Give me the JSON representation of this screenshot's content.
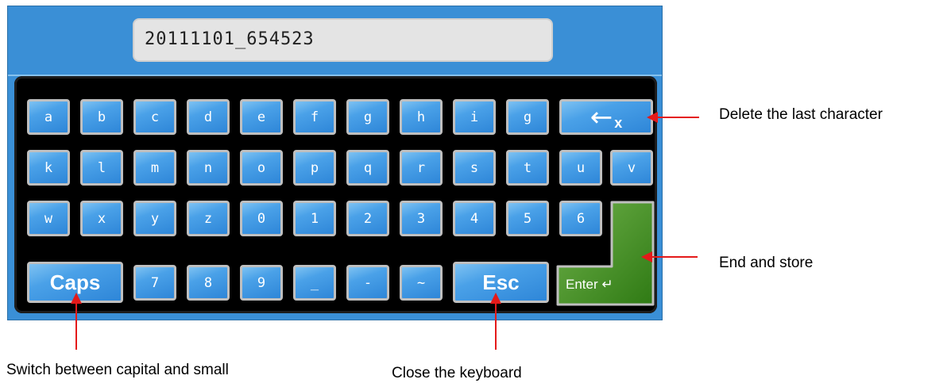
{
  "display": {
    "value": "20111101_654523"
  },
  "keys": {
    "row1": [
      "a",
      "b",
      "c",
      "d",
      "e",
      "f",
      "g",
      "h",
      "i",
      "g"
    ],
    "row2": [
      "k",
      "l",
      "m",
      "n",
      "o",
      "p",
      "q",
      "r",
      "s",
      "t",
      "u",
      "v"
    ],
    "row3": [
      "w",
      "x",
      "y",
      "z",
      "0",
      "1",
      "2",
      "3",
      "4",
      "5",
      "6"
    ],
    "row4": [
      "7",
      "8",
      "9",
      "_",
      "-",
      "~"
    ],
    "backspace_symbol": "←",
    "backspace_x": "x",
    "caps": "Caps",
    "esc": "Esc",
    "enter": "Enter ↵"
  },
  "annotations": {
    "delete": "Delete the last character",
    "enter": "End and store",
    "caps": "Switch between capital and small",
    "esc": "Close the keyboard"
  },
  "colors": {
    "panel": "#3a8fd6",
    "key": "#2e86d8",
    "enter": "#3f8f1f",
    "arrow": "#e41a1a"
  }
}
